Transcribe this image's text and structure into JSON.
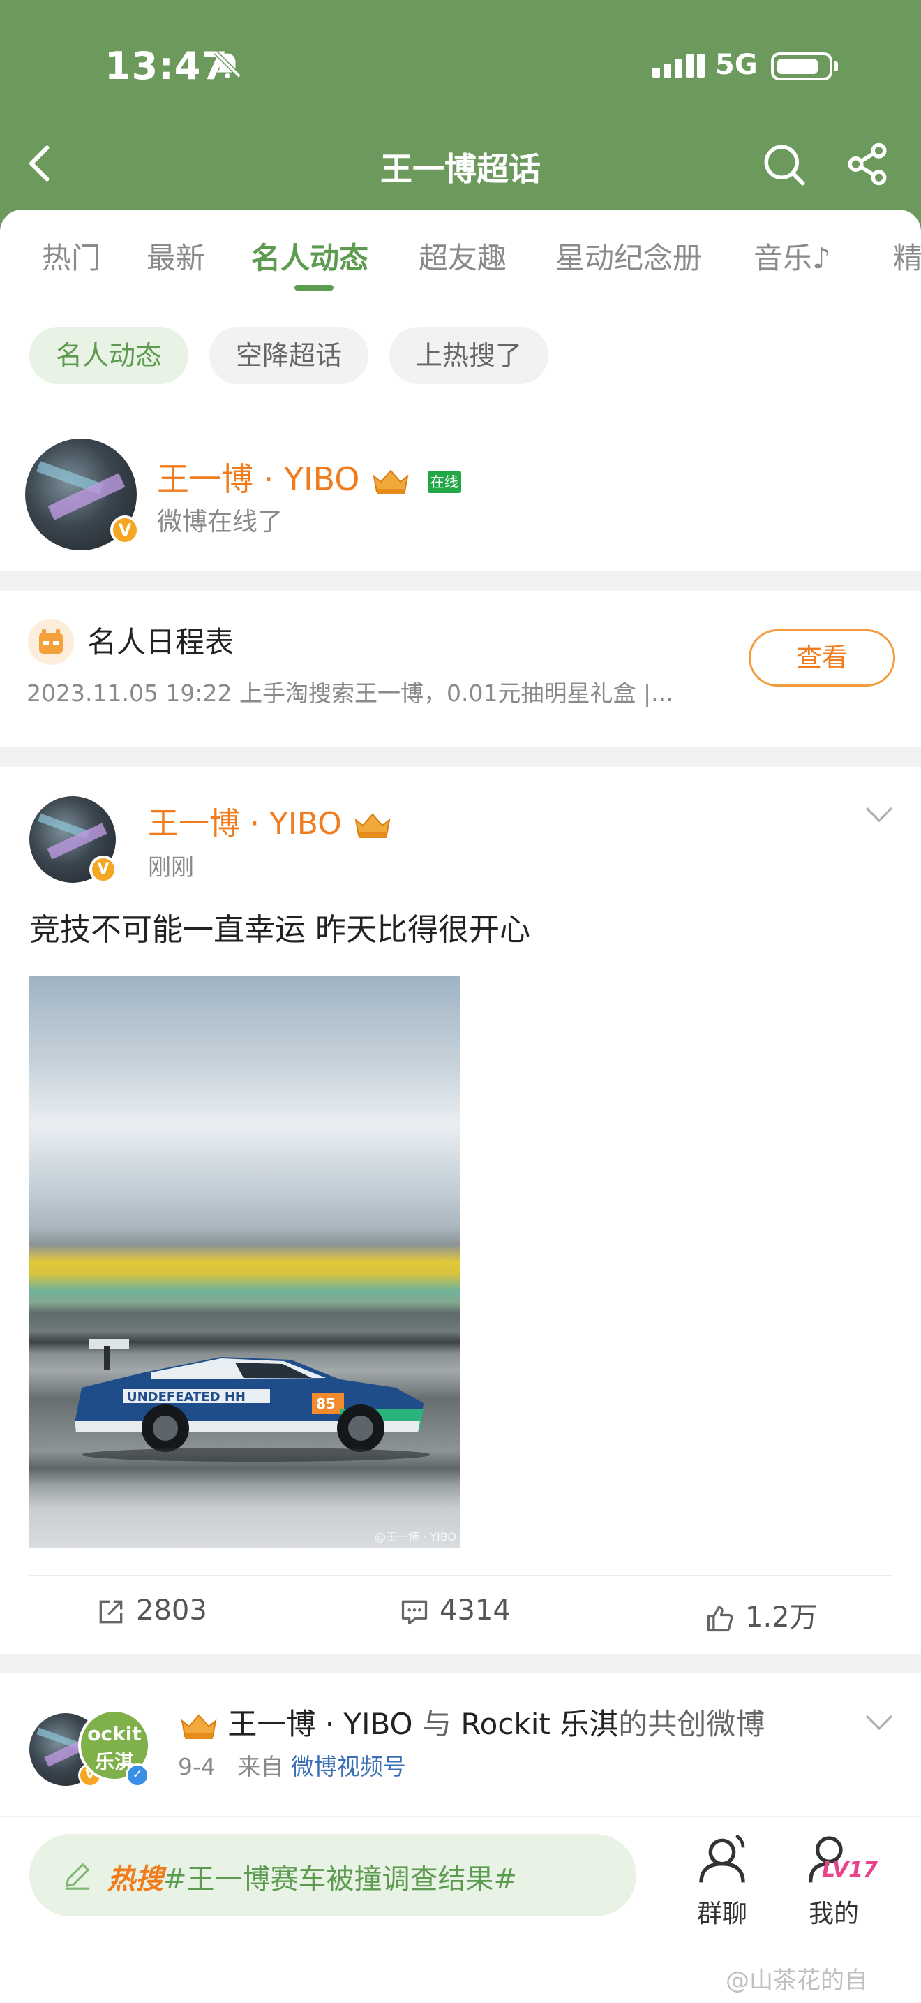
{
  "status": {
    "time": "13:47",
    "network": "5G"
  },
  "nav": {
    "title": "王一博超话"
  },
  "tabs": [
    "热门",
    "最新",
    "名人动态",
    "超友趣",
    "星动纪念册",
    "音乐♪",
    "精"
  ],
  "active_tab": "名人动态",
  "chips": [
    "名人动态",
    "空降超话",
    "上热搜了"
  ],
  "profile": {
    "name": "王一博 · YIBO",
    "online": "在线",
    "subtitle": "微博在线了"
  },
  "schedule": {
    "title": "名人日程表",
    "subtitle": "2023.11.05 19:22 上手淘搜索王一博，0.01元抽明星礼盒 |...",
    "button": "查看"
  },
  "post": {
    "author": "王一博 · YIBO",
    "time": "刚刚",
    "text": "竞技不可能一直幸运 昨天比得很开心",
    "image_watermark": "@王一博 · YIBO",
    "reposts": "2803",
    "comments": "4314",
    "likes": "1.2万"
  },
  "post2": {
    "author": "王一博 · YIBO",
    "connector": "与",
    "coauthor": "Rockit 乐淇",
    "suffix": "的共创微博",
    "date": "9-4",
    "source_prefix": "来自",
    "source": "微博视频号",
    "coavatar_text": "ockit\n乐淇"
  },
  "bottom": {
    "hot_label": "热搜",
    "hot_topic": "#王一博赛车被撞调查结果#",
    "group_chat": "群聊",
    "mine": "我的",
    "level": "LV17"
  },
  "footer_watermark": "@山茶花的自",
  "colors": {
    "header_green": "#6b9a5c",
    "accent_green": "#5d9b50",
    "name_orange": "#f07c1e"
  }
}
